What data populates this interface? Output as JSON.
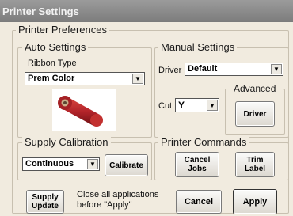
{
  "window": {
    "title": "Printer Settings"
  },
  "preferences": {
    "legend": "Printer Preferences"
  },
  "auto_settings": {
    "legend": "Auto Settings",
    "ribbon_label": "Ribbon Type",
    "ribbon_value": "Prem Color",
    "ribbon_icon": "ribbon-roll-icon"
  },
  "manual_settings": {
    "legend": "Manual Settings",
    "driver_label": "Driver",
    "driver_value": "Default",
    "cut_label": "Cut",
    "cut_value": "Y",
    "advanced_legend": "Advanced",
    "driver_button": "Driver"
  },
  "supply_calibration": {
    "legend": "Supply Calibration",
    "value": "Continuous",
    "button": "Calibrate"
  },
  "printer_commands": {
    "legend": "Printer Commands",
    "cancel_jobs": "Cancel Jobs",
    "trim_label": "Trim Label"
  },
  "footer": {
    "supply_update": "Supply Update",
    "note": "Close all applications before \"Apply\"",
    "cancel": "Cancel",
    "apply": "Apply"
  },
  "colors": {
    "titlebar": "#888888",
    "background": "#f1ebdf",
    "ribbon": "#b3242a"
  }
}
